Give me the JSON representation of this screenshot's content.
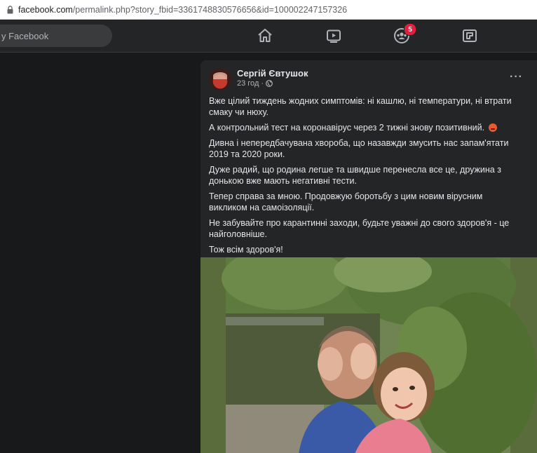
{
  "browser": {
    "url_host": "facebook.com",
    "url_path": "/permalink.php?story_fbid=3361748830576656&id=100002247157326",
    "lock_icon": "lock-icon"
  },
  "topnav": {
    "search_placeholder": "у Facebook",
    "icons": [
      "home-icon",
      "watch-icon",
      "groups-icon",
      "gaming-icon"
    ],
    "groups_badge": "5"
  },
  "post": {
    "author": "Сергій Євтушок",
    "time": "23 год",
    "dot": "·",
    "privacy_icon": "globe-icon",
    "more_icon": "more-options-icon",
    "more_label": "···",
    "paragraphs": [
      "Вже цілий тиждень жодних симптомів: ні кашлю, ні температури, ні втрати смаку чи нюху.",
      "А контрольний тест на коронавірус через 2 тижні знову позитивний.",
      "Дивна і непередбачувана хвороба, що назавжди змусить нас запам'ятати 2019 та 2020 роки.",
      "Дуже радий, що родина легше та швидше перенесла все це, дружина з донькою вже мають негативні тести.",
      "Тепер справа за мною. Продовжую боротьбу з цим новим вірусним викликом на самоізоляції.",
      "Не забувайте про карантинні заходи, будьте уважні до свого здоров'я - це найголовніше.",
      "Тож всім здоров'я!"
    ],
    "emoji_icon": "angry-face-emoji-icon",
    "photo_icon": "post-photo"
  },
  "colors": {
    "page_bg": "#18191a",
    "card_bg": "#242526",
    "badge": "#e41e3f",
    "text": "#e4e6eb",
    "secondary_text": "#b0b3b8"
  }
}
